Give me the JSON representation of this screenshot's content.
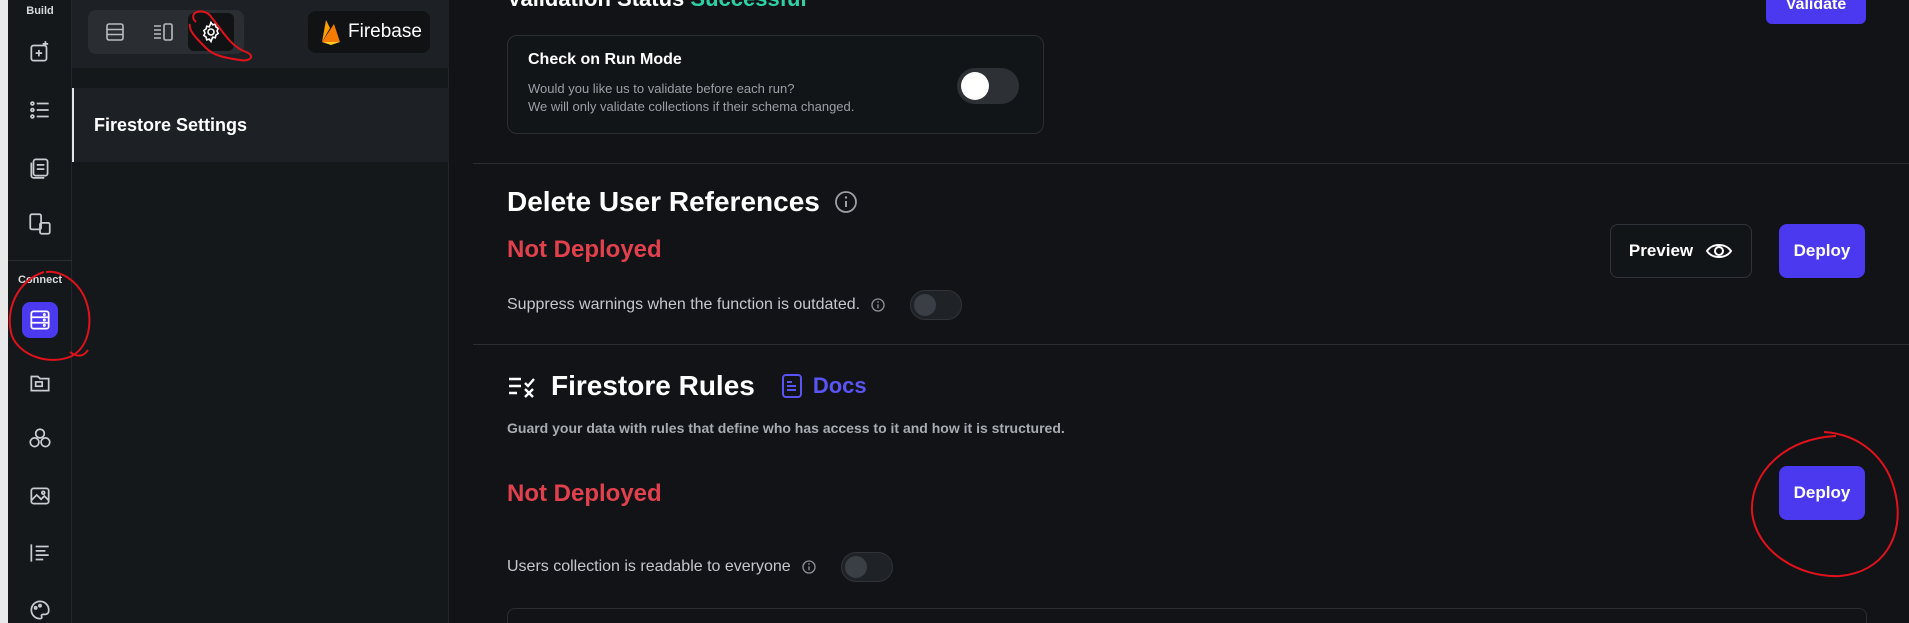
{
  "rail": {
    "build_label": "Build",
    "connect_label": "Connect",
    "icons": [
      "add-page-icon",
      "list-icon",
      "pages-icon",
      "responsive-icon",
      "database-icon",
      "folder-icon",
      "integrations-icon",
      "media-icon",
      "align-icon",
      "palette-icon"
    ]
  },
  "panel": {
    "tabs": [
      "database-view-icon",
      "split-view-icon",
      "settings-gear-icon"
    ],
    "firebase_label": "Firebase",
    "item_label": "Firestore Settings"
  },
  "validation": {
    "label": "Validation Status",
    "value": "Successful",
    "button_label": "Validate"
  },
  "run_mode": {
    "title": "Check on Run Mode",
    "line1": "Would you like us to validate before each run?",
    "line2": "We will only validate collections if their schema changed.",
    "enabled": false
  },
  "delete_refs": {
    "title": "Delete User References",
    "status": "Not Deployed",
    "suppress_label": "Suppress warnings when the function is outdated.",
    "preview_label": "Preview",
    "deploy_label": "Deploy"
  },
  "firestore_rules": {
    "title": "Firestore Rules",
    "docs_label": "Docs",
    "description": "Guard your data with rules that define who has access to it and how it is structured.",
    "status": "Not Deployed",
    "deploy_label": "Deploy",
    "readable_label": "Users collection is readable to everyone"
  },
  "colors": {
    "accent": "#4b39ef",
    "success": "#2ed1a4",
    "error": "#e0414d",
    "annotation": "#e0121b"
  }
}
